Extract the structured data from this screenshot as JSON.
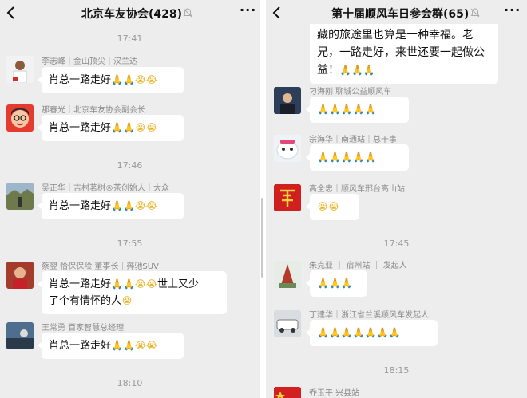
{
  "left": {
    "title": "北京车友协会(428)",
    "messages": [
      {
        "time": "17:41"
      },
      {
        "name": "李志峰｜金山顶尖｜汉兰达",
        "text": "肖总一路走好"
      },
      {
        "name": "那春光｜北京车友协会副会长",
        "text": "肖总一路走好"
      },
      {
        "time": "17:46"
      },
      {
        "name": "吴正华｜吉村茗树®茶创始人｜大众",
        "text": "肖总一路走好"
      },
      {
        "time": "17:55"
      },
      {
        "name": "蔡翌 恰保保险 董事长｜奔驰SUV",
        "text": "肖总一路走好",
        "text_tail": "世上又少",
        "text_line2": "了个有情怀的人"
      },
      {
        "name": "王常勇 百家智慧总经理",
        "text": "肖总一路走好"
      },
      {
        "time": "18:10"
      }
    ]
  },
  "right": {
    "title": "第十届顺风车日参会群(65)",
    "top_message": {
      "line1": "藏的旅途里也算是一种幸福。老",
      "line2": "兄，一路走好，来世还要一起做公",
      "line3": "益！"
    },
    "messages": [
      {
        "name": "刁海刚 聊城公益顺风车"
      },
      {
        "name": "宗海华｜南通站｜总干事"
      },
      {
        "name": "高全忠｜顺风车邢台高山站"
      },
      {
        "time": "17:45"
      },
      {
        "name": "朱克亚 ｜ 宿州站 ｜ 发起人"
      },
      {
        "name": "丁建华｜浙江省兰溪顺风车发起人"
      },
      {
        "time": "18:15"
      },
      {
        "name": "乔玉平 兴县站"
      }
    ]
  },
  "icons": {
    "back": "chevron-left-icon",
    "mute": "bell-off-icon",
    "more": "more-dots-icon",
    "pray": "folded-hands-emoji",
    "cry": "crying-face-emoji"
  },
  "colors": {
    "background": "#ededed",
    "bubble": "#ffffff",
    "text": "#111111",
    "meta": "#9a9a9a"
  }
}
